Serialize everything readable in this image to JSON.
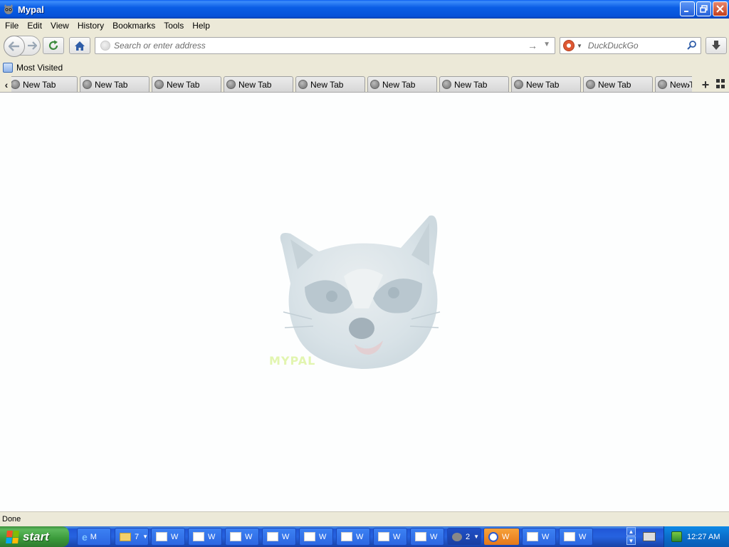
{
  "window": {
    "title": "Mypal"
  },
  "menubar": {
    "items": [
      "File",
      "Edit",
      "View",
      "History",
      "Bookmarks",
      "Tools",
      "Help"
    ]
  },
  "navbar": {
    "url_placeholder": "Search or enter address",
    "url_value": "",
    "search_placeholder": "DuckDuckGo",
    "search_value": ""
  },
  "bookmarks": {
    "items": [
      {
        "label": "Most Visited"
      }
    ]
  },
  "tabs": {
    "items": [
      "New Tab",
      "New Tab",
      "New Tab",
      "New Tab",
      "New Tab",
      "New Tab",
      "New Tab",
      "New Tab",
      "New Tab",
      "New Tab"
    ]
  },
  "content": {
    "logo_text": "MYPAL"
  },
  "statusbar": {
    "text": "Done"
  },
  "taskbar": {
    "start_label": "start",
    "buttons": [
      {
        "icon": "ie-icon",
        "label": "M"
      },
      {
        "icon": "folder-icon",
        "label": "7"
      },
      {
        "icon": "window-icon",
        "label": "W"
      },
      {
        "icon": "window-icon",
        "label": "W"
      },
      {
        "icon": "window-icon",
        "label": "W"
      },
      {
        "icon": "window-icon",
        "label": "W"
      },
      {
        "icon": "window-icon",
        "label": "W"
      },
      {
        "icon": "window-icon",
        "label": "W"
      },
      {
        "icon": "window-icon",
        "label": "W"
      },
      {
        "icon": "window-icon",
        "label": "W"
      },
      {
        "icon": "mypal-icon",
        "label": "2"
      },
      {
        "icon": "media-icon",
        "label": "W"
      },
      {
        "icon": "window-icon",
        "label": "W"
      },
      {
        "icon": "window-icon",
        "label": "W"
      }
    ],
    "clock": "12:27 AM"
  },
  "colors": {
    "titlebar_blue": "#0a5ee5",
    "taskbar_blue": "#2663e0",
    "start_green": "#3a9a3a",
    "page_background": "#fdfefe"
  }
}
